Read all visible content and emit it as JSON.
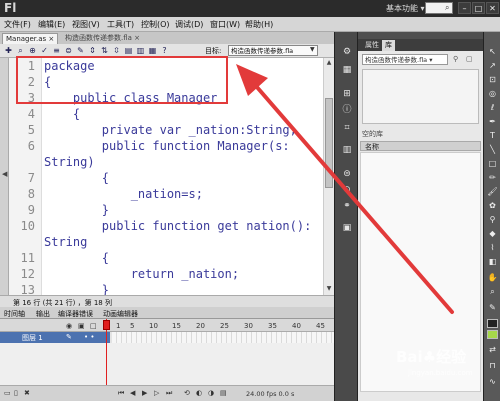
{
  "app": {
    "logo": "Fl",
    "workspace": "基本功能 ▾",
    "window_controls": {
      "minimize": "–",
      "maximize": "□",
      "close": "✕"
    }
  },
  "menu": [
    "文件(F)",
    "编辑(E)",
    "视图(V)",
    "工具(T)",
    "控制(O)",
    "调试(D)",
    "窗口(W)",
    "帮助(H)"
  ],
  "doc_tabs": {
    "active": "Manager.as ×",
    "other": "构造函数传递参数.fla ×"
  },
  "script_toolbar": {
    "target_label": "目标:",
    "target_value": "构造函数传递参数.fla"
  },
  "code_lines": [
    {
      "n": "1",
      "text": "package"
    },
    {
      "n": "2",
      "text": "{"
    },
    {
      "n": "3",
      "text": "    public class Manager"
    },
    {
      "n": "4",
      "text": "    {"
    },
    {
      "n": "5",
      "text": "        private var _nation:String;"
    },
    {
      "n": "6",
      "text": "        public function Manager(s:"
    },
    {
      "n": "",
      "text": "String)"
    },
    {
      "n": "7",
      "text": "        {"
    },
    {
      "n": "8",
      "text": "            _nation=s;"
    },
    {
      "n": "9",
      "text": "        }"
    },
    {
      "n": "10",
      "text": "        public function get nation():"
    },
    {
      "n": "",
      "text": "String"
    },
    {
      "n": "11",
      "text": "        {"
    },
    {
      "n": "12",
      "text": "            return _nation;"
    },
    {
      "n": "13",
      "text": "        }"
    }
  ],
  "status": {
    "text": "第 16 行 (共 21 行) ，第 18 列"
  },
  "timeline": {
    "tabs": [
      "时间轴",
      "输出",
      "编译器错误",
      "动画编辑器"
    ],
    "ticks": [
      "1",
      "5",
      "10",
      "15",
      "20",
      "25",
      "30",
      "35",
      "40",
      "45"
    ],
    "layer_name": "图层 1",
    "fps": "24.00 fps   0.0 s"
  },
  "panel": {
    "tab_properties": "属性",
    "tab_library": "库",
    "doc_select": "构造函数传递参数.fla ▾",
    "search_label": "空的库",
    "name_column": "名称"
  },
  "watermark": {
    "logo": "Bai♣经验",
    "url": "jingyan.baidu.com"
  },
  "colors": {
    "annotation": "#e23a3a",
    "layer_selected": "#4c72b0",
    "fill_swatch": "#a6d84a"
  }
}
